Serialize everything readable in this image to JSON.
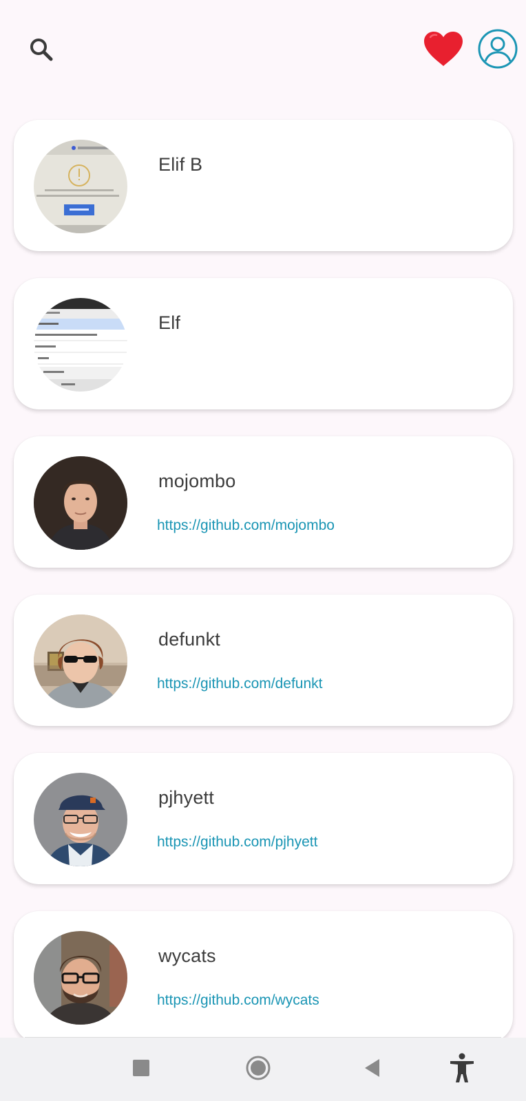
{
  "topbar": {
    "left_icon": "search-icon",
    "right_icons": [
      "heart-icon",
      "account-circle-icon"
    ]
  },
  "colors": {
    "background": "#fdf7fb",
    "heart": "#e8202f",
    "accent": "#1a95b4",
    "text": "#3b3b3b"
  },
  "users": [
    {
      "name": "Elif B",
      "url": "",
      "avatar": "screenshot-image"
    },
    {
      "name": "Elf",
      "url": "",
      "avatar": "screenshot-image"
    },
    {
      "name": "mojombo",
      "url": "https://github.com/mojombo",
      "avatar": "photo"
    },
    {
      "name": "defunkt",
      "url": "https://github.com/defunkt",
      "avatar": "photo"
    },
    {
      "name": "pjhyett",
      "url": "https://github.com/pjhyett",
      "avatar": "photo"
    },
    {
      "name": "wycats",
      "url": "https://github.com/wycats",
      "avatar": "photo"
    }
  ],
  "navbar": {
    "icons": [
      "recents-square-icon",
      "home-circle-icon",
      "back-triangle-icon",
      "accessibility-icon"
    ]
  }
}
